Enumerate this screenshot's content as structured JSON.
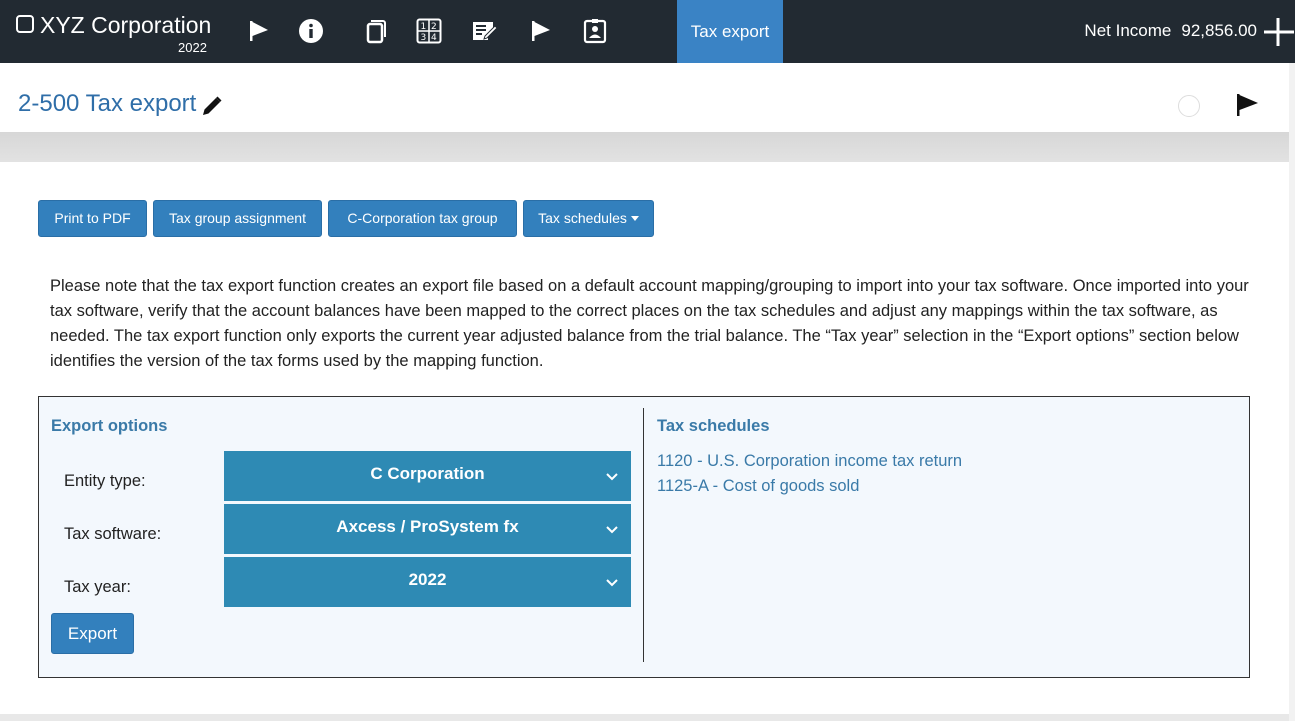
{
  "topbar": {
    "company": "XYZ Corporation",
    "year": "2022",
    "active_tab": "Tax export",
    "net_income_label": "Net Income",
    "net_income_value": "92,856.00",
    "icons": [
      "flag-icon",
      "info-icon",
      "copy-icon",
      "numbers-icon",
      "edit-note-icon",
      "flag-icon",
      "badge-icon",
      "plus-icon"
    ]
  },
  "header": {
    "title": "2-500 Tax export"
  },
  "toolbar": {
    "print_pdf": "Print to PDF",
    "tax_group_assignment": "Tax group assignment",
    "c_corp_group": "C-Corporation tax group",
    "tax_schedules": "Tax schedules"
  },
  "note": "Please note that the tax export function creates an export file based on a default account mapping/grouping to import into your tax software. Once imported into your tax software, verify that the account balances have been mapped to the correct places on the tax schedules and adjust any mappings within the tax software, as needed. The tax export function only exports the current year adjusted balance from the trial balance. The “Tax year” selection in the “Export options” section below identifies the version of the tax forms used by the mapping function.",
  "export_options": {
    "title": "Export options",
    "entity_label": "Entity type:",
    "entity_value": "C Corporation",
    "software_label": "Tax software:",
    "software_value": "Axcess / ProSystem fx",
    "year_label": "Tax year:",
    "year_value": "2022",
    "export_button": "Export"
  },
  "tax_schedules": {
    "title": "Tax schedules",
    "items": [
      "1120 - U.S. Corporation income tax return",
      "1125-A - Cost of goods sold"
    ]
  },
  "colors": {
    "topbar": "#222a32",
    "accent": "#3380bd",
    "select": "#2e8ab4",
    "link": "#3a7aa8"
  }
}
